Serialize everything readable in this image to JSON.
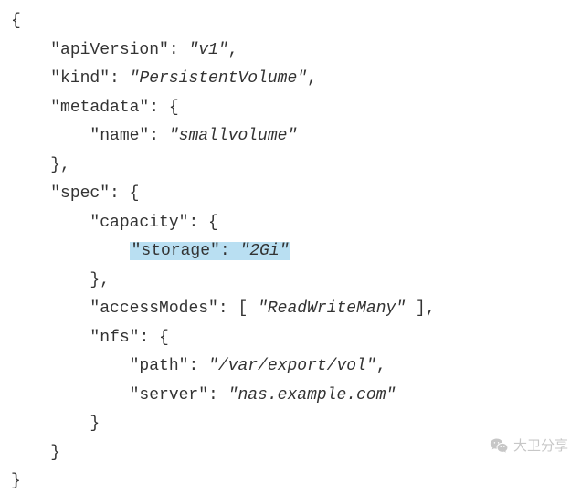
{
  "code": {
    "line1": "{",
    "line2_key": "\"apiVersion\"",
    "line2_val": "\"v1\"",
    "line3_key": "\"kind\"",
    "line3_val": "\"PersistentVolume\"",
    "line4_key": "\"metadata\"",
    "line5_key": "\"name\"",
    "line5_val": "\"smallvolume\"",
    "line7_key": "\"spec\"",
    "line8_key": "\"capacity\"",
    "line9_key": "\"storage\"",
    "line9_val": "\"2Gi\"",
    "line11_key": "\"accessModes\"",
    "line11_val": "\"ReadWriteMany\"",
    "line12_key": "\"nfs\"",
    "line13_key": "\"path\"",
    "line13_val": "\"/var/export/vol\"",
    "line14_key": "\"server\"",
    "line14_val": "\"nas.example.com\""
  },
  "watermark": {
    "text": "大卫分享"
  }
}
